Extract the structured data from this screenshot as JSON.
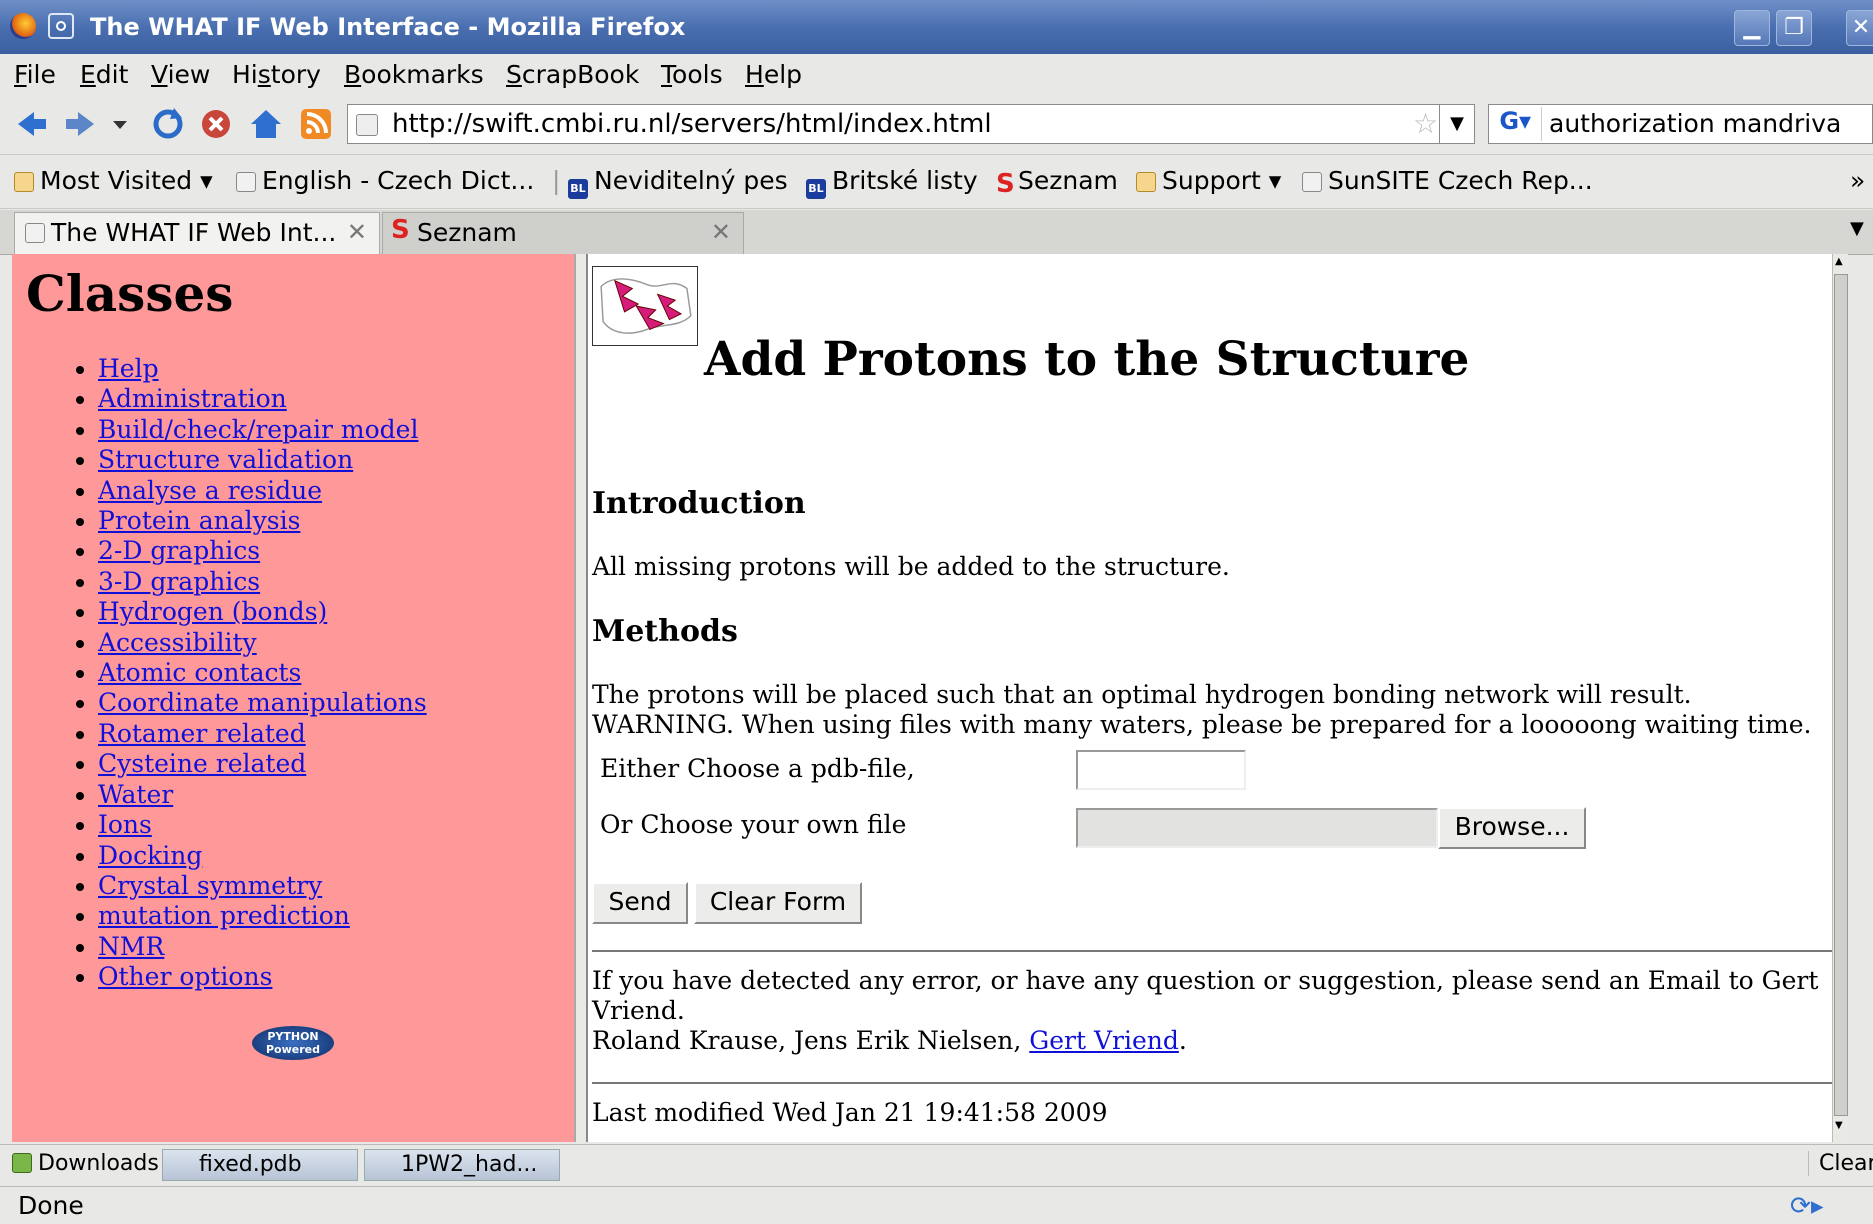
{
  "window": {
    "title": "The WHAT IF Web Interface - Mozilla Firefox"
  },
  "menu": {
    "items": [
      {
        "label": "File",
        "accel": "F",
        "rest": "ile"
      },
      {
        "label": "Edit",
        "accel": "E",
        "rest": "dit"
      },
      {
        "label": "View",
        "accel": "V",
        "rest": "iew"
      },
      {
        "label": "History",
        "pre": "Hi",
        "accel": "s",
        "rest": "tory"
      },
      {
        "label": "Bookmarks",
        "accel": "B",
        "rest": "ookmarks"
      },
      {
        "label": "ScrapBook",
        "accel": "S",
        "rest": "crapBook"
      },
      {
        "label": "Tools",
        "accel": "T",
        "rest": "ools"
      },
      {
        "label": "Help",
        "accel": "H",
        "rest": "elp"
      }
    ]
  },
  "nav": {
    "url": "http://swift.cmbi.ru.nl/servers/html/index.html",
    "search_value": "authorization mandriva"
  },
  "bookmarks": {
    "most_visited": "Most Visited",
    "english_czech": "English - Czech Dict...",
    "neviditelny": "Neviditelný pes",
    "britske": "Britské listy",
    "seznam": "Seznam",
    "support": "Support",
    "sunsite": "SunSITE Czech Rep...",
    "bl_badge": "BL",
    "more": "»"
  },
  "tabs": [
    {
      "label": "The WHAT IF Web Int...",
      "active": true
    },
    {
      "label": "Seznam",
      "active": false
    }
  ],
  "sidebar": {
    "heading": "Classes",
    "links": [
      "Help",
      "Administration",
      "Build/check/repair model",
      "Structure validation",
      "Analyse a residue",
      "Protein analysis",
      "2-D graphics",
      "3-D graphics",
      "Hydrogen (bonds)",
      "Accessibility",
      "Atomic contacts",
      "Coordinate manipulations",
      "Rotamer related",
      "Cysteine related",
      "Water",
      "Ions",
      "Docking",
      "Crystal symmetry",
      "mutation prediction",
      "NMR",
      "Other options"
    ],
    "badge_line1": "PYTHON",
    "badge_line2": "Powered"
  },
  "main": {
    "title": "Add Protons to the Structure",
    "intro_heading": "Introduction",
    "intro_text": "All missing protons will be added to the structure.",
    "methods_heading": "Methods",
    "methods_line1": "The protons will be placed such that an optimal hydrogen bonding network will result.",
    "methods_line2": "WARNING. When using files with many waters, please be prepared for a looooong waiting time.",
    "pdb_label": "Either Choose a pdb-file,",
    "pdb_value": "",
    "file_label": "Or Choose your own file",
    "browse_label": "Browse...",
    "send_label": "Send",
    "clear_label": "Clear Form",
    "contact_line1": "If you have detected any error, or have any question or suggestion, please send an Email to Gert",
    "contact_line2": "Vriend.",
    "authors_prefix": "Roland Krause, Jens Erik Nielsen, ",
    "author_link": "Gert Vriend",
    "authors_suffix": ".",
    "last_modified": "Last modified Wed Jan 21 19:41:58 2009"
  },
  "downloads": {
    "label": "Downloads",
    "items": [
      "fixed.pdb",
      "1PW2_had..."
    ],
    "clear_label": "Clear"
  },
  "status": {
    "text": "Done"
  },
  "colors": {
    "sidebar_bg": "#ff9898",
    "link": "#1010d8",
    "titlebar": "#4a6fb0"
  }
}
